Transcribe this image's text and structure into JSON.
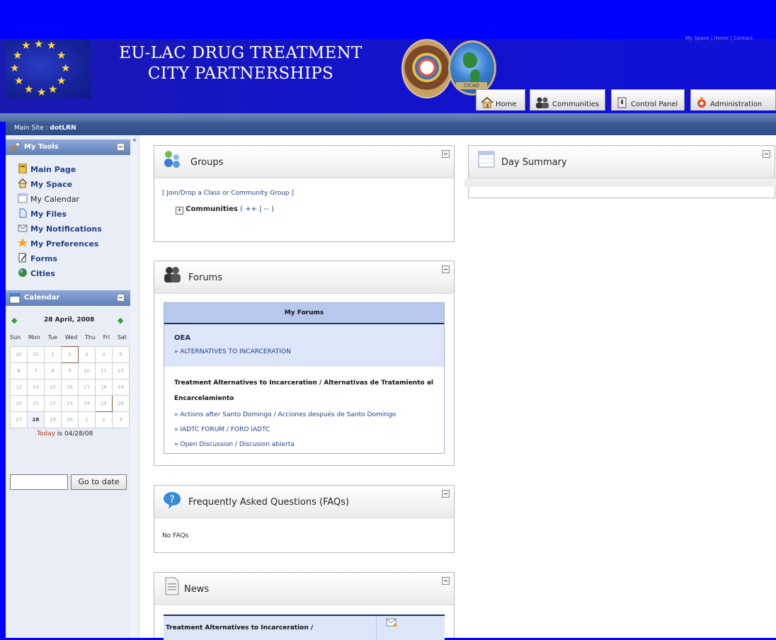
{
  "banner": {
    "title_line1": "EU-LAC DRUG TREATMENT",
    "title_line2": "CITY PARTNERSHIPS",
    "top_right_links": "My Space | Home | Contact"
  },
  "top_tabs": [
    {
      "label": "Home"
    },
    {
      "label": "Communities"
    },
    {
      "label": "Control Panel"
    },
    {
      "label": "Administration"
    }
  ],
  "breadcrumb": {
    "prefix": "Main Site : ",
    "current": "dotLRN"
  },
  "sidebar": {
    "my_tools_title": "My Tools",
    "items": [
      {
        "label": "Main Page"
      },
      {
        "label": "My Space"
      },
      {
        "label": "My Calendar"
      },
      {
        "label": "My Files"
      },
      {
        "label": "My Notifications"
      },
      {
        "label": "My Preferences"
      },
      {
        "label": "Forms"
      },
      {
        "label": "Cities"
      }
    ],
    "calendar_title": "Calendar",
    "calendar": {
      "month_label": "28 April, 2008",
      "days_of_week": [
        "Sun",
        "Mon",
        "Tue",
        "Wed",
        "Thu",
        "Fri",
        "Sat"
      ],
      "weeks": [
        [
          "30",
          "31",
          "1",
          "2",
          "3",
          "4",
          "5"
        ],
        [
          "6",
          "7",
          "8",
          "9",
          "10",
          "11",
          "12"
        ],
        [
          "13",
          "14",
          "15",
          "16",
          "17",
          "18",
          "19"
        ],
        [
          "20",
          "21",
          "22",
          "23",
          "24",
          "25",
          "26"
        ],
        [
          "27",
          "28",
          "29",
          "30",
          "1",
          "2",
          "3"
        ]
      ],
      "today_word": "Today",
      "today_rest": " is 04/28/08",
      "go_button": "Go to date",
      "date_input_value": ""
    }
  },
  "groups": {
    "title": "Groups",
    "join_link": "[ Join/Drop a Class or Community Group ]",
    "communities_label": "Communities",
    "communities_links": "( ++ | -- )"
  },
  "forums": {
    "title": "Forums",
    "my_forums_header": "My Forums",
    "group1_name": "OEA",
    "group1_link": "» ALTERNATIVES TO INCARCERATION",
    "group2_name_line1": "Treatment Alternatives to Incarceration / Alternativas de Tratamiento al",
    "group2_name_line2": "Encarcelamiento",
    "group2_links": [
      "» Actions after Santo Domingo / Acciones después de Santo Domingo",
      "» IADTC FORUM / FORO IADTC",
      "» Open Discussion / Discusion abierta"
    ]
  },
  "faqs": {
    "title": "Frequently Asked Questions (FAQs)",
    "empty_text": "No FAQs"
  },
  "news": {
    "title": "News",
    "row_label": "Treatment Alternatives to Incarceration /"
  },
  "day_summary": {
    "title": "Day Summary"
  },
  "colors": {
    "banner_blue": "#0000ff",
    "link_blue": "#24408a",
    "header_blue": "#5f7fb8"
  }
}
